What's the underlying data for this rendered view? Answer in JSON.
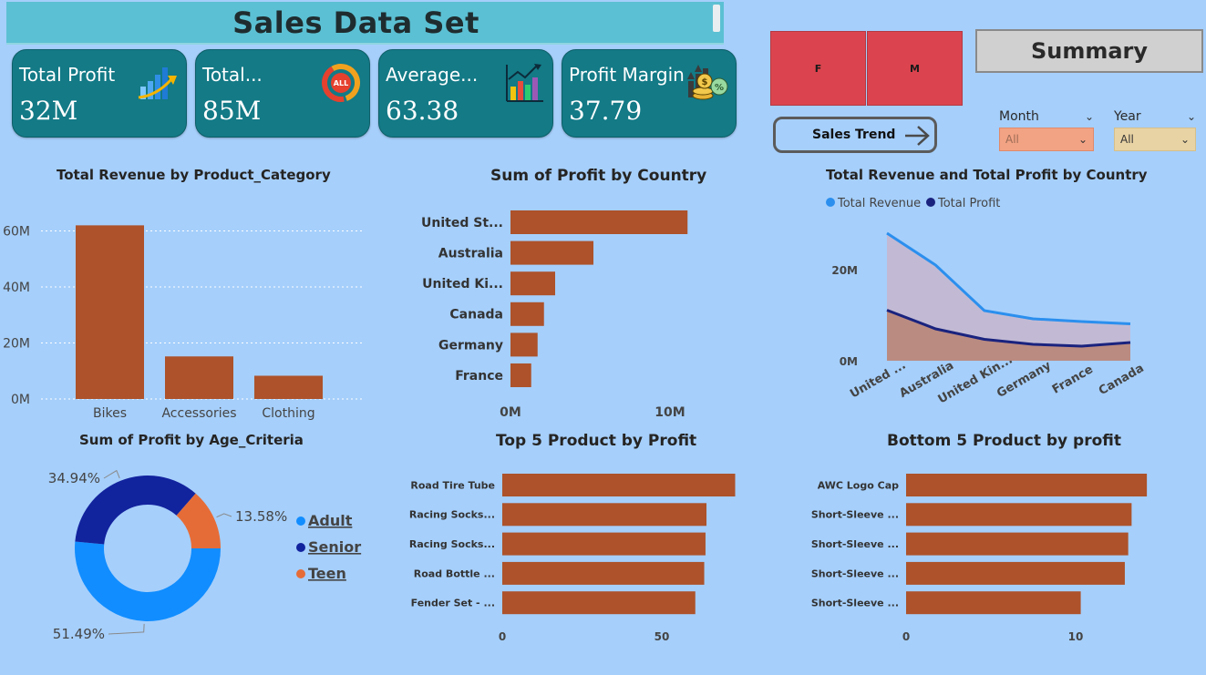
{
  "header": {
    "title": "Sales Data Set"
  },
  "kpis": [
    {
      "label": "Total Profit",
      "value": "32M",
      "icon": "bar-growth-icon"
    },
    {
      "label": "Total...",
      "value": "85M",
      "icon": "all-ring-icon"
    },
    {
      "label": "Average...",
      "value": "63.38",
      "icon": "analytics-chart-icon"
    },
    {
      "label": "Profit Margin",
      "value": "37.79",
      "icon": "money-growth-icon"
    }
  ],
  "gender_buttons": [
    "F",
    "M"
  ],
  "summary_button": "Summary",
  "sales_trend_button": "Sales Trend",
  "slicers": {
    "month": {
      "title": "Month",
      "value": "All"
    },
    "year": {
      "title": "Year",
      "value": "All"
    }
  },
  "colors": {
    "bar": "#ad522a",
    "revenue_line": "#2b8fee",
    "profit_line": "#1a237e",
    "adult": "#118dff",
    "senior": "#12239e",
    "teen": "#e66c37",
    "kpi_card": "#137a86",
    "gender_button": "#db444e"
  },
  "chart_data": [
    {
      "id": "revenue_by_category",
      "type": "bar",
      "title": "Total Revenue by Product_Category",
      "categories": [
        "Bikes",
        "Accessories",
        "Clothing"
      ],
      "values": [
        62,
        15.2,
        8.3
      ],
      "unit": "M",
      "yticks": [
        "0M",
        "20M",
        "40M",
        "60M"
      ],
      "ylim": [
        0,
        67
      ],
      "grid": true
    },
    {
      "id": "profit_by_country",
      "type": "bar",
      "orientation": "horizontal",
      "title": "Sum of Profit by Country",
      "categories": [
        "United St...",
        "Australia",
        "United Ki...",
        "Canada",
        "Germany",
        "France"
      ],
      "values": [
        11.1,
        5.2,
        2.8,
        2.1,
        1.7,
        1.3
      ],
      "unit": "M",
      "xticks": [
        "0M",
        "10M"
      ],
      "xlim": [
        0,
        12
      ]
    },
    {
      "id": "revenue_profit_by_country",
      "type": "area",
      "title": "Total Revenue and Total Profit by Country",
      "categories": [
        "United ...",
        "Australia",
        "United Kin...",
        "Germany",
        "France",
        "Canada"
      ],
      "series": [
        {
          "name": "Total Revenue",
          "values": [
            28,
            21,
            11,
            9.2,
            8.6,
            8.1
          ]
        },
        {
          "name": "Total Profit",
          "values": [
            11.1,
            7,
            4.7,
            3.6,
            3.2,
            4
          ]
        }
      ],
      "yticks": [
        "0M",
        "20M"
      ],
      "ylim": [
        0,
        30
      ],
      "legend": "top-left"
    },
    {
      "id": "profit_by_age",
      "type": "pie",
      "donut": true,
      "title": "Sum of Profit by Age_Criteria",
      "labels": [
        "Adult",
        "Senior",
        "Teen"
      ],
      "values": [
        51.49,
        34.94,
        13.58
      ],
      "value_labels": [
        "51.49%",
        "34.94%",
        "13.58%"
      ],
      "legend": "right"
    },
    {
      "id": "top5_products",
      "type": "bar",
      "orientation": "horizontal",
      "title": "Top 5 Product by Profit",
      "categories": [
        "Road Tire Tube",
        "Racing Socks...",
        "Racing Socks...",
        "Road Bottle ...",
        "Fender Set - ..."
      ],
      "values": [
        73,
        64,
        63.7,
        63.3,
        60.5
      ],
      "xticks": [
        "0",
        "50"
      ],
      "xlim": [
        0,
        80
      ]
    },
    {
      "id": "bottom5_products",
      "type": "bar",
      "orientation": "horizontal",
      "title": "Bottom 5 Product by profit",
      "categories": [
        "AWC Logo Cap",
        "Short-Sleeve ...",
        "Short-Sleeve ...",
        "Short-Sleeve ...",
        "Short-Sleeve ..."
      ],
      "values": [
        14.2,
        13.3,
        13.1,
        12.9,
        10.3
      ],
      "xticks": [
        "0",
        "10"
      ],
      "xlim": [
        0,
        15
      ]
    }
  ]
}
